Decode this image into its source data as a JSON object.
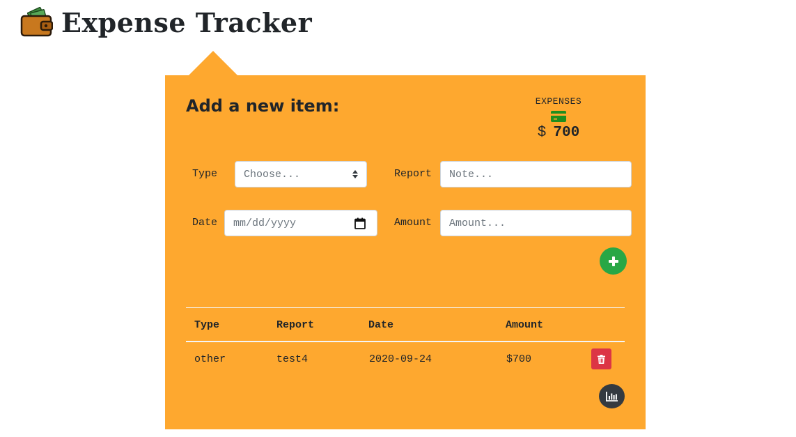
{
  "app": {
    "title": "Expense Tracker",
    "icon": "wallet-icon"
  },
  "form": {
    "heading": "Add a new item:",
    "type_label": "Type",
    "type_selected": "Choose...",
    "report_label": "Report",
    "report_placeholder": "Note...",
    "date_label": "Date",
    "date_placeholder": "mm/dd/yyyy",
    "amount_label": "Amount",
    "amount_placeholder": "Amount...",
    "add_icon": "plus-icon"
  },
  "expenses": {
    "label": "EXPENSES",
    "currency": "$",
    "total": "700",
    "icon": "credit-card-icon"
  },
  "table": {
    "headers": [
      "Type",
      "Report",
      "Date",
      "Amount"
    ],
    "rows": [
      {
        "type": "other",
        "report": "test4",
        "date": "2020-09-24",
        "amount": "$700",
        "delete_icon": "trash-icon"
      }
    ]
  },
  "footer": {
    "chart_icon": "bar-chart-icon"
  },
  "colors": {
    "panel": "#fea82f",
    "add_button": "#28a745",
    "delete_button": "#dc3545",
    "chart_button": "#343a40",
    "card_icon": "#1e8e1e"
  }
}
